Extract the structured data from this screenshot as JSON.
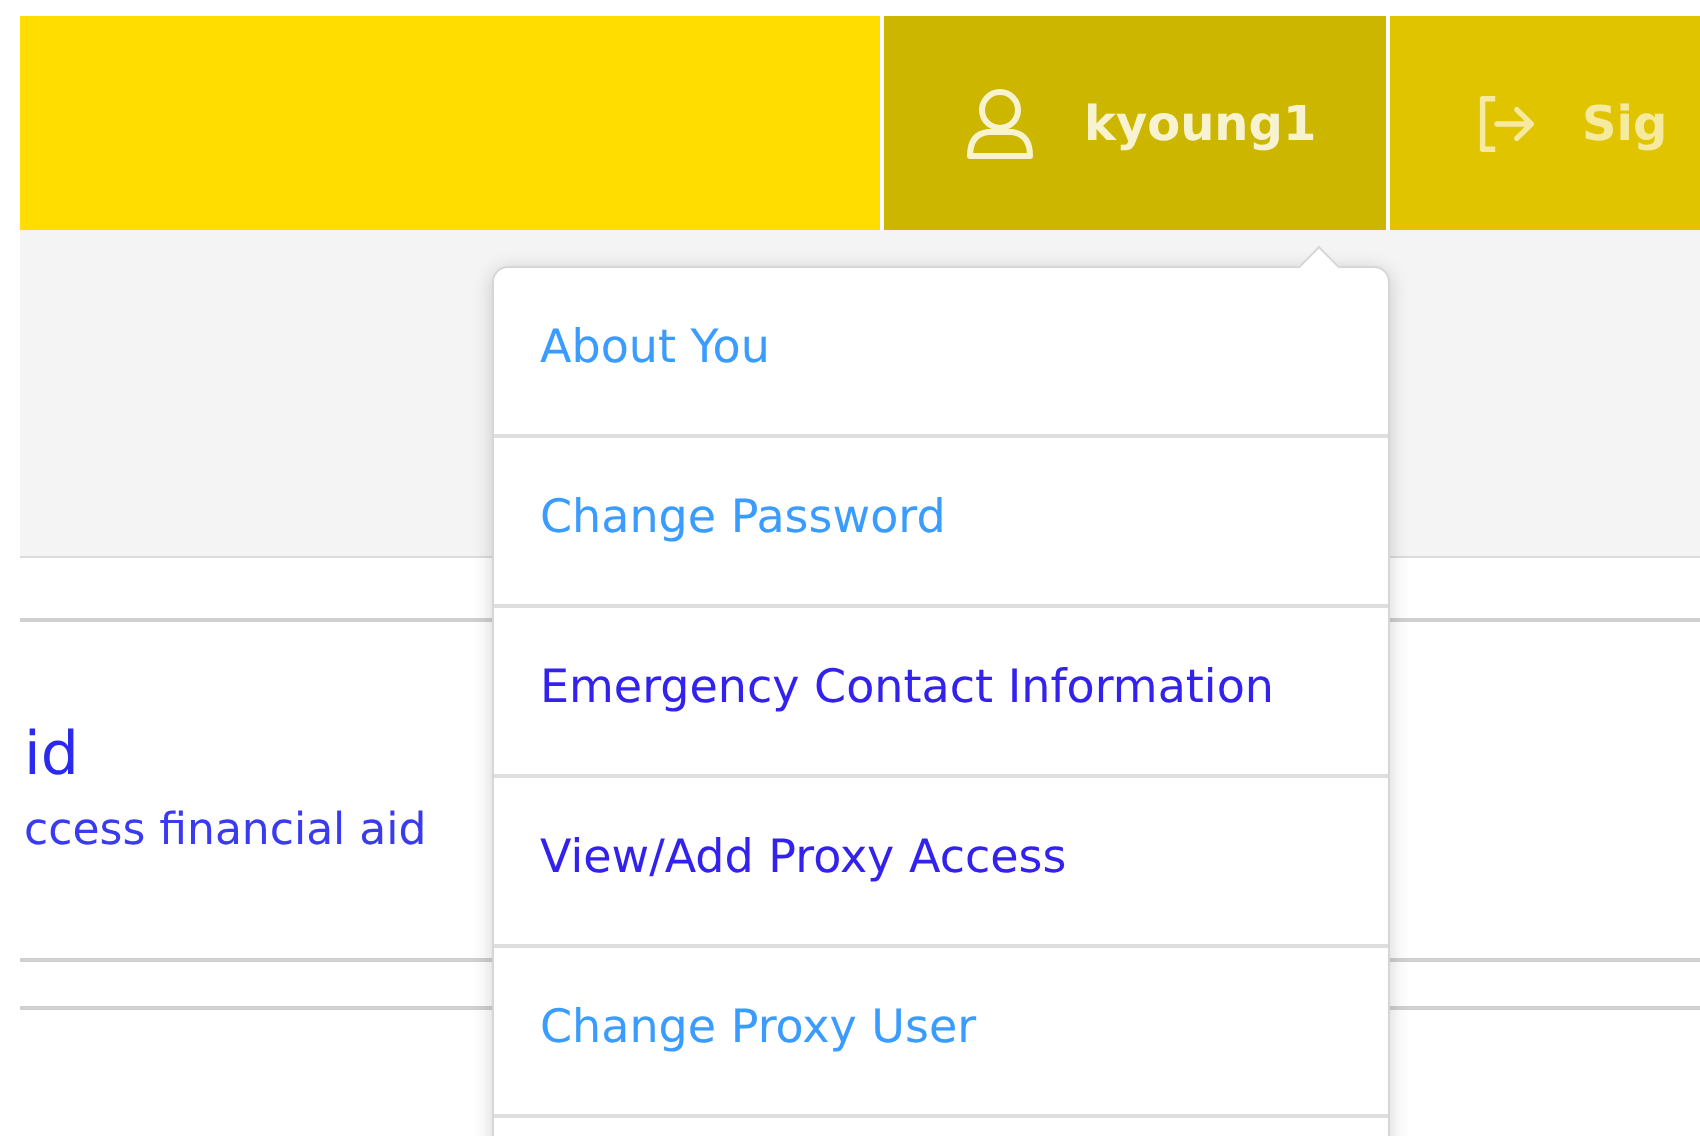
{
  "header": {
    "user_button": {
      "label": "kyoung1",
      "expanded": true
    },
    "sign_out_button": {
      "label": "Sig"
    }
  },
  "card": {
    "title": "id",
    "description": "ccess financial aid"
  },
  "user_menu": {
    "items": [
      {
        "label": "About You",
        "visited": false
      },
      {
        "label": "Change Password",
        "visited": false
      },
      {
        "label": "Emergency Contact Information",
        "visited": true
      },
      {
        "label": "View/Add Proxy Access",
        "visited": true
      },
      {
        "label": "Change Proxy User",
        "visited": false
      }
    ]
  }
}
